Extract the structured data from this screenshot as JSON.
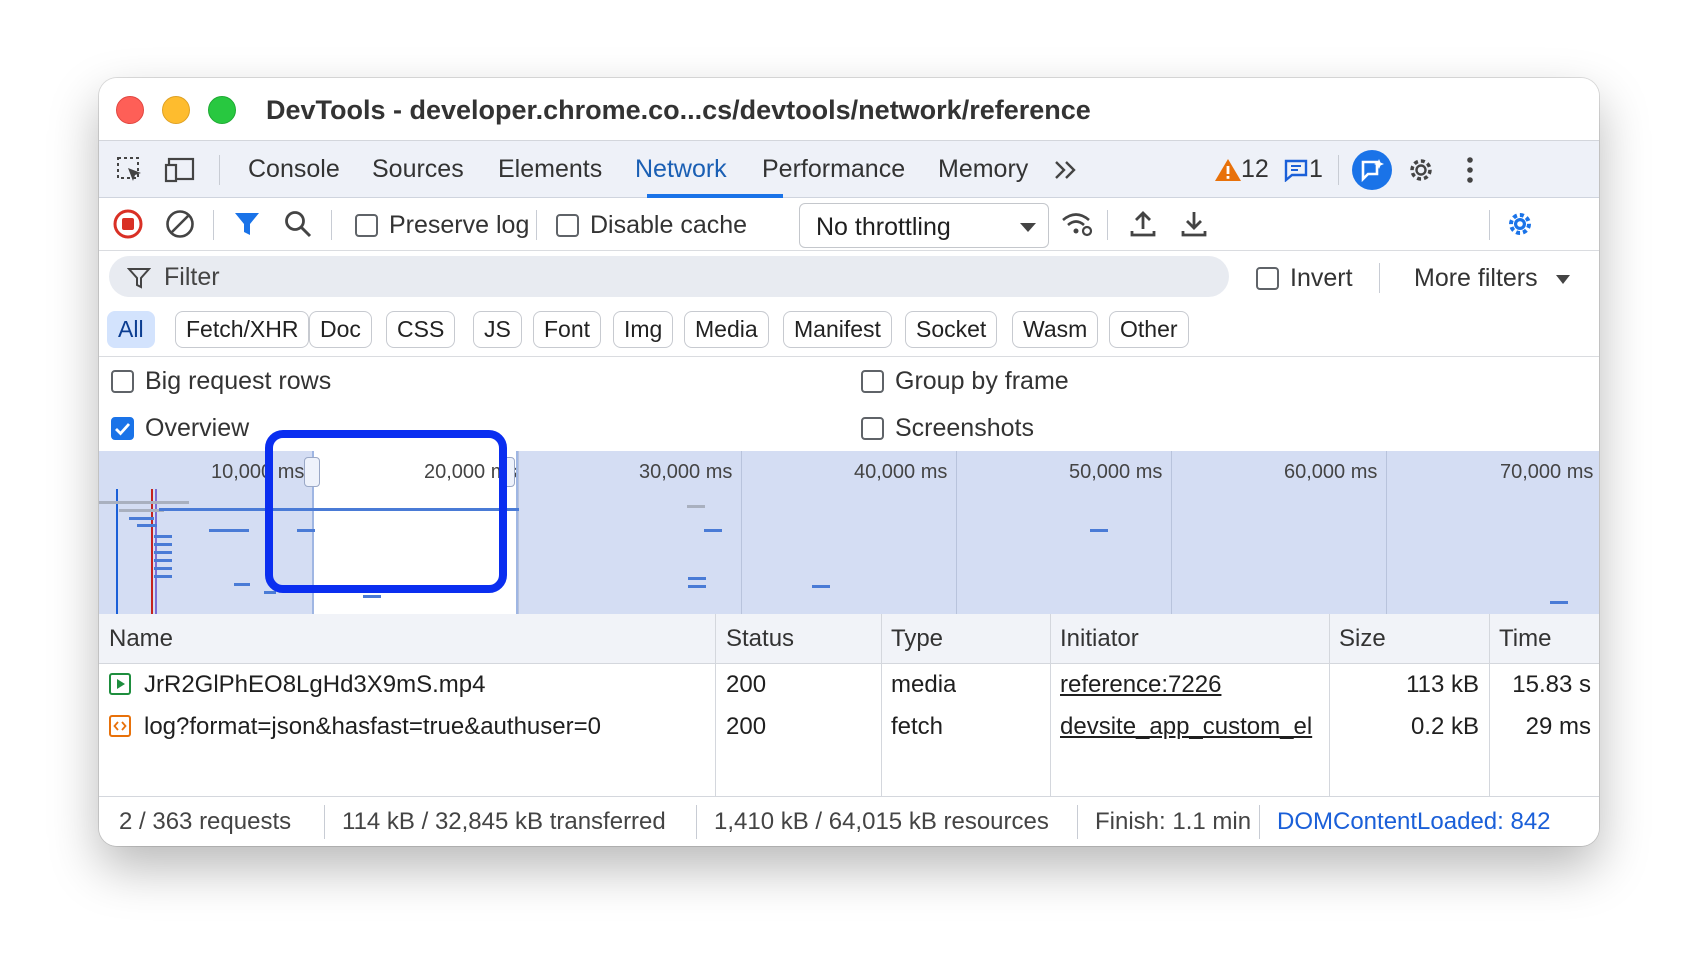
{
  "window": {
    "title": "DevTools - developer.chrome.co...cs/devtools/network/reference"
  },
  "tabs": {
    "items": [
      {
        "label": "Console"
      },
      {
        "label": "Sources"
      },
      {
        "label": "Elements"
      },
      {
        "label": "Network"
      },
      {
        "label": "Performance"
      },
      {
        "label": "Memory"
      }
    ],
    "active": "Network",
    "warnings_count": "12",
    "messages_count": "1"
  },
  "toolbar": {
    "preserve_log_label": "Preserve log",
    "preserve_log_checked": false,
    "disable_cache_label": "Disable cache",
    "disable_cache_checked": false,
    "throttling_value": "No throttling"
  },
  "filter": {
    "placeholder": "Filter",
    "invert_label": "Invert",
    "more_filters_label": "More filters"
  },
  "type_filters": {
    "items": [
      "All",
      "Fetch/XHR",
      "Doc",
      "CSS",
      "JS",
      "Font",
      "Img",
      "Media",
      "Manifest",
      "Socket",
      "Wasm",
      "Other"
    ],
    "active": "All"
  },
  "options": {
    "big_request_rows_label": "Big request rows",
    "big_request_rows_checked": false,
    "overview_label": "Overview",
    "overview_checked": true,
    "group_by_frame_label": "Group by frame",
    "group_by_frame_checked": false,
    "screenshots_label": "Screenshots",
    "screenshots_checked": false
  },
  "overview": {
    "ticks": [
      "10,000 ms",
      "20,000 ms",
      "30,000 ms",
      "40,000 ms",
      "50,000 ms",
      "60,000 ms",
      "70,000 ms"
    ],
    "colors": {
      "bar": "#4a7bd6",
      "grey": "#a9b0bf",
      "selection": "#0a2ef0"
    }
  },
  "table": {
    "headers": {
      "name": "Name",
      "status": "Status",
      "type": "Type",
      "initiator": "Initiator",
      "size": "Size",
      "time": "Time"
    },
    "rows": [
      {
        "icon": "media-file-icon",
        "name": "JrR2GlPhEO8LgHd3X9mS.mp4",
        "status": "200",
        "type": "media",
        "initiator": "reference:7226",
        "size": "113 kB",
        "time": "15.83 s"
      },
      {
        "icon": "fetch-file-icon",
        "name": "log?format=json&hasfast=true&authuser=0",
        "status": "200",
        "type": "fetch",
        "initiator": "devsite_app_custom_el",
        "size": "0.2 kB",
        "time": "29 ms"
      }
    ]
  },
  "status": {
    "requests": "2 / 363 requests",
    "transferred": "114 kB / 32,845 kB transferred",
    "resources": "1,410 kB / 64,015 kB resources",
    "finish": "Finish: 1.1 min",
    "dcl": "DOMContentLoaded: 842"
  }
}
